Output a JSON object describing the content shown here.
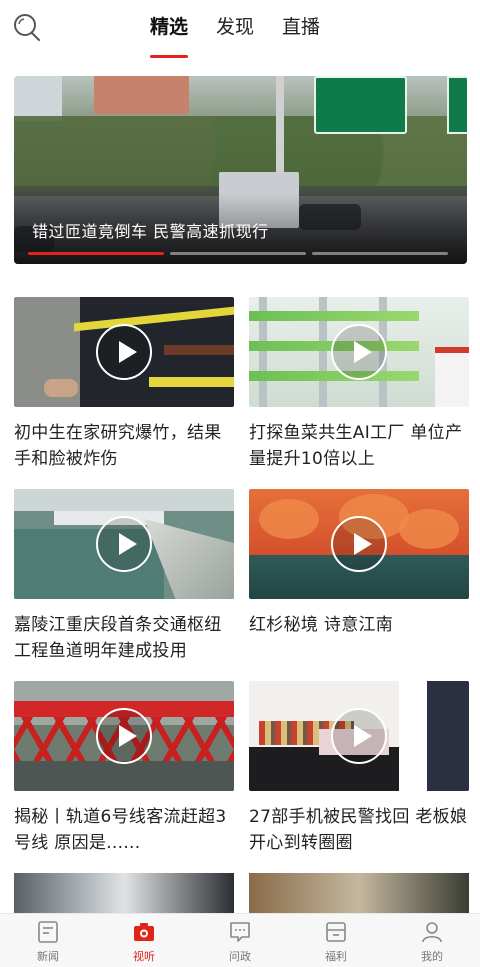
{
  "header": {
    "tabs": [
      {
        "label": "精选",
        "active": true
      },
      {
        "label": "发现",
        "active": false
      },
      {
        "label": "直播",
        "active": false
      }
    ]
  },
  "hero": {
    "title": "错过匝道竟倒车 民警高速抓现行",
    "slide_count": 3,
    "active_slide": 1
  },
  "videos": [
    {
      "title": "初中生在家研究爆竹，结果手和脸被炸伤"
    },
    {
      "title": "打探鱼菜共生AI工厂 单位产量提升10倍以上"
    },
    {
      "title": "嘉陵江重庆段首条交通枢纽工程鱼道明年建成投用"
    },
    {
      "title": "红杉秘境 诗意江南"
    },
    {
      "title": "揭秘丨轨道6号线客流赶超3号线 原因是......"
    },
    {
      "title": "27部手机被民警找回 老板娘开心到转圈圈"
    }
  ],
  "bottom_nav": [
    {
      "label": "新闻",
      "icon": "news-icon",
      "active": false
    },
    {
      "label": "视听",
      "icon": "camera-icon",
      "active": true
    },
    {
      "label": "问政",
      "icon": "chat-icon",
      "active": false
    },
    {
      "label": "福利",
      "icon": "gift-icon",
      "active": false
    },
    {
      "label": "我的",
      "icon": "user-icon",
      "active": false
    }
  ],
  "colors": {
    "accent": "#e2231a",
    "nav_inactive": "#777777"
  }
}
